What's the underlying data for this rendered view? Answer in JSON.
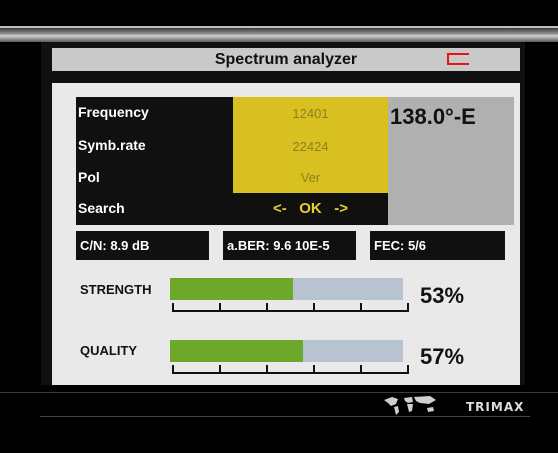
{
  "header": {
    "title": "Spectrum analyzer",
    "exit_icon": "exit-icon"
  },
  "info": {
    "frequency_label": "Frequency",
    "frequency_value": "12401",
    "symbrate_label": "Symb.rate",
    "symbrate_value": "22424",
    "pol_label": "Pol",
    "pol_value": "Ver",
    "search_label": "Search",
    "search_value": "<-   OK   ->",
    "satellite_position": "138.0°-E"
  },
  "stats": {
    "cn": "C/N: 8.9 dB",
    "ber": "a.BER: 9.6 10E-5",
    "fec": "FEC: 5/6"
  },
  "meters": {
    "strength_label": "STRENGTH",
    "strength_text": "53%",
    "strength_value": 53,
    "quality_label": "QUALITY",
    "quality_text": "57%",
    "quality_value": 57
  },
  "footer": {
    "brand": "TRIMAX",
    "map_icon": "world-map-icon"
  },
  "colors": {
    "highlight": "#d8c021",
    "bar_fill": "#6da82b",
    "bar_empty": "#b7c3cf",
    "accent": "#e11111"
  }
}
